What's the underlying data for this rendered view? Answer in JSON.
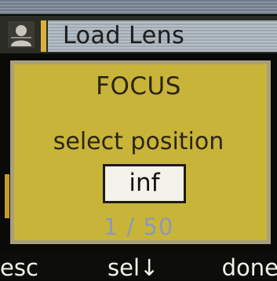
{
  "title_bar": {
    "title": "Load Lens",
    "icon": "person-icon"
  },
  "dialog": {
    "heading": "FOCUS",
    "prompt": "select position",
    "value": "inf",
    "counter": "1 / 50"
  },
  "softkeys": {
    "left": "esc",
    "center": "sel↓",
    "right": "done"
  },
  "colors": {
    "dialog_bg": "#c9b43a",
    "title_panel": "#b7bfc6",
    "accent": "#d8b23a",
    "counter_text": "#8a9ab8"
  }
}
